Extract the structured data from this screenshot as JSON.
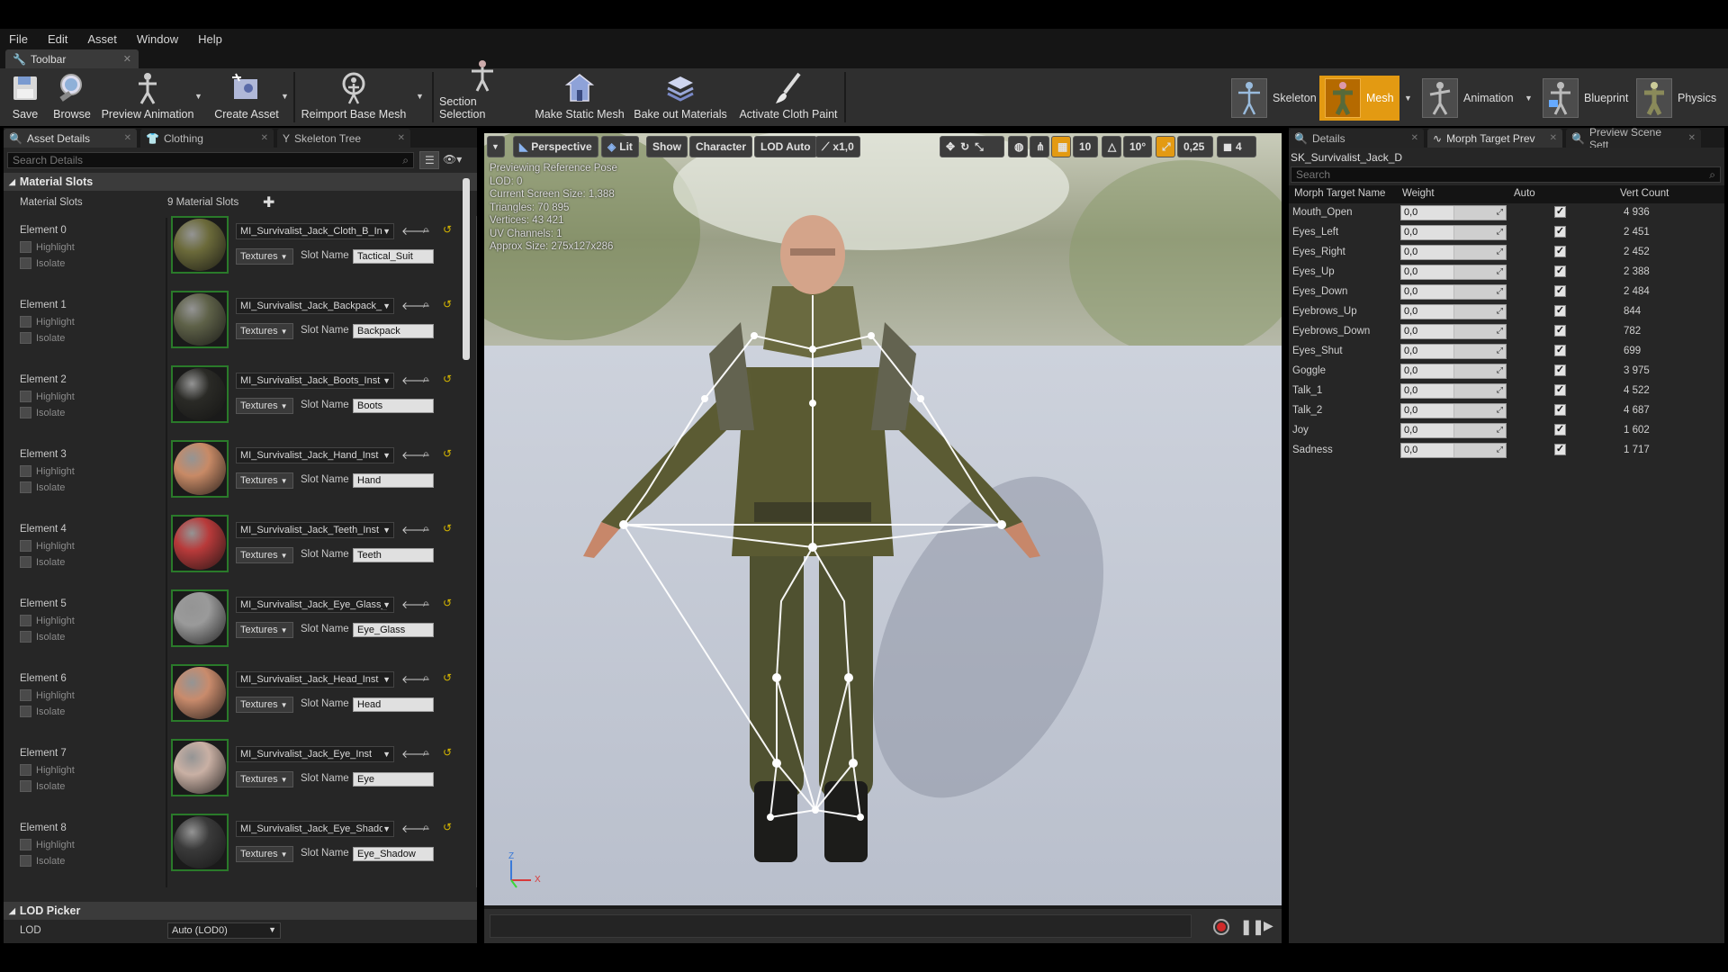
{
  "menu": [
    "File",
    "Edit",
    "Asset",
    "Window",
    "Help"
  ],
  "toolbar_tab": "Toolbar",
  "toolbar": {
    "buttons": [
      {
        "label": "Save",
        "icon": "save-icon"
      },
      {
        "label": "Browse",
        "icon": "browse-icon"
      },
      {
        "label": "Preview Animation",
        "icon": "preview-animation-icon"
      },
      {
        "label": "Create Asset",
        "icon": "create-asset-icon"
      },
      {
        "label": "Reimport Base Mesh",
        "icon": "reimport-icon"
      },
      {
        "label": "Section Selection",
        "icon": "section-selection-icon"
      },
      {
        "label": "Make Static Mesh",
        "icon": "make-static-mesh-icon"
      },
      {
        "label": "Bake out Materials",
        "icon": "bake-materials-icon"
      },
      {
        "label": "Activate Cloth Paint",
        "icon": "cloth-paint-icon"
      }
    ],
    "modes": [
      {
        "label": "Skeleton",
        "active": false
      },
      {
        "label": "Mesh",
        "active": true
      },
      {
        "label": "Animation",
        "active": false
      },
      {
        "label": "Blueprint",
        "active": false
      },
      {
        "label": "Physics",
        "active": false
      }
    ],
    "active_mode_color": "#e39a12"
  },
  "left_panel": {
    "tabs": [
      "Asset Details",
      "Clothing",
      "Skeleton Tree"
    ],
    "search_placeholder": "Search Details",
    "category_material": "Material Slots",
    "material_slots_label": "Material Slots",
    "material_slots_count": "9 Material Slots",
    "highlight_label": "Highlight",
    "isolate_label": "Isolate",
    "textures_label": "Textures",
    "slot_name_label": "Slot Name",
    "elements": [
      {
        "name": "Element 0",
        "material": "MI_Survivalist_Jack_Cloth_B_Ins",
        "slot": "Tactical_Suit",
        "color": "#6b6a3a"
      },
      {
        "name": "Element 1",
        "material": "MI_Survivalist_Jack_Backpack_",
        "slot": "Backpack",
        "color": "#5e6148"
      },
      {
        "name": "Element 2",
        "material": "MI_Survivalist_Jack_Boots_Inst",
        "slot": "Boots",
        "color": "#2a2a26"
      },
      {
        "name": "Element 3",
        "material": "MI_Survivalist_Jack_Hand_Inst",
        "slot": "Hand",
        "color": "#c88a66"
      },
      {
        "name": "Element 4",
        "material": "MI_Survivalist_Jack_Teeth_Inst",
        "slot": "Teeth",
        "color": "#b83a3a"
      },
      {
        "name": "Element 5",
        "material": "MI_Survivalist_Jack_Eye_Glass_",
        "slot": "Eye_Glass",
        "color": "#9a9a9a"
      },
      {
        "name": "Element 6",
        "material": "MI_Survivalist_Jack_Head_Inst",
        "slot": "Head",
        "color": "#c98b6c"
      },
      {
        "name": "Element 7",
        "material": "MI_Survivalist_Jack_Eye_Inst",
        "slot": "Eye",
        "color": "#c9b0a4"
      },
      {
        "name": "Element 8",
        "material": "MI_Survivalist_Jack_Eye_Shadov",
        "slot": "Eye_Shadow",
        "color": "#3a3a3a"
      }
    ],
    "category_lod": "LOD Picker",
    "lod_label": "LOD",
    "lod_value": "Auto (LOD0)"
  },
  "viewport": {
    "buttons": [
      "Perspective",
      "Lit",
      "Show",
      "Character",
      "LOD Auto",
      "x1,0"
    ],
    "grid_value": "10",
    "rot_value": "10°",
    "scale_value": "0,25",
    "cam_speed": "4",
    "info_lines": [
      "Previewing Reference Pose",
      "LOD: 0",
      "Current Screen Size: 1,388",
      "Triangles: 70 895",
      "Vertices: 43 421",
      "UV Channels: 1",
      "Approx Size: 275x127x286"
    ],
    "axis_z": "Z",
    "axis_x": "X"
  },
  "right_panel": {
    "tabs": [
      "Details",
      "Morph Target Prev",
      "Preview Scene Sett"
    ],
    "asset_name": "SK_Survivalist_Jack_D",
    "search_placeholder": "Search",
    "columns": [
      "Morph Target Name",
      "Weight",
      "Auto",
      "Vert Count"
    ],
    "rows": [
      {
        "name": "Mouth_Open",
        "weight": "0,0",
        "vert": "4 936"
      },
      {
        "name": "Eyes_Left",
        "weight": "0,0",
        "vert": "2 451"
      },
      {
        "name": "Eyes_Right",
        "weight": "0,0",
        "vert": "2 452"
      },
      {
        "name": "Eyes_Up",
        "weight": "0,0",
        "vert": "2 388"
      },
      {
        "name": "Eyes_Down",
        "weight": "0,0",
        "vert": "2 484"
      },
      {
        "name": "Eyebrows_Up",
        "weight": "0,0",
        "vert": "844"
      },
      {
        "name": "Eyebrows_Down",
        "weight": "0,0",
        "vert": "782"
      },
      {
        "name": "Eyes_Shut",
        "weight": "0,0",
        "vert": "699"
      },
      {
        "name": "Goggle",
        "weight": "0,0",
        "vert": "3 975"
      },
      {
        "name": "Talk_1",
        "weight": "0,0",
        "vert": "4 522"
      },
      {
        "name": "Talk_2",
        "weight": "0,0",
        "vert": "4 687"
      },
      {
        "name": "Joy",
        "weight": "0,0",
        "vert": "1 602"
      },
      {
        "name": "Sadness",
        "weight": "0,0",
        "vert": "1 717"
      }
    ]
  }
}
